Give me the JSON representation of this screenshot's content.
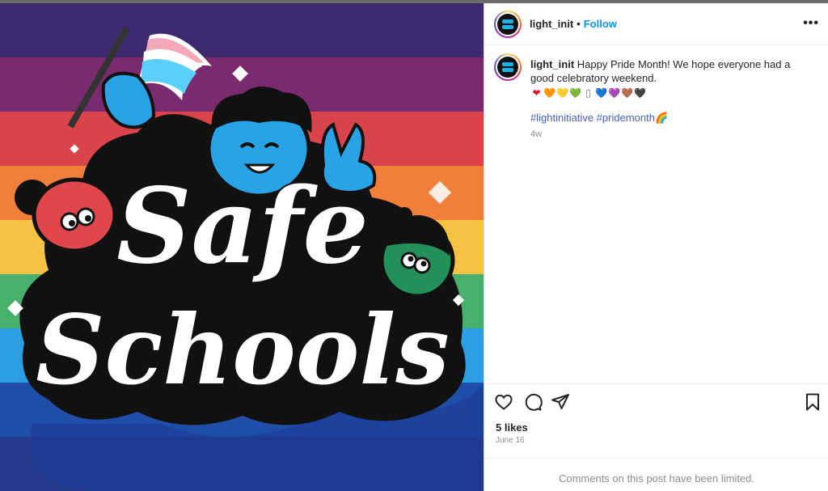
{
  "post_image": {
    "artwork_title_line1": "Safe",
    "artwork_title_line2": "Schools",
    "stripe_colors": [
      "#3e2a6e",
      "#7a2a6e",
      "#d9434a",
      "#f07f3a",
      "#f6c244",
      "#47b06d",
      "#2a9ee0",
      "#1f4ea8",
      "#233a8a"
    ]
  },
  "header": {
    "username": "light_init",
    "separator": "•",
    "follow_label": "Follow",
    "more_label": "•••"
  },
  "caption": {
    "username": "light_init",
    "text_line": "Happy Pride Month! We hope everyone had a good celebratory weekend.",
    "hearts": [
      "❤",
      "🧡",
      "💛",
      "💚",
      "▯",
      "💙",
      "💜",
      "🤎",
      "🖤"
    ],
    "heart_colors": [
      "#e0162b",
      "#f57c00",
      "#f4c20d",
      "#3cb043",
      "#777777",
      "#1e88e5",
      "#8e44ad",
      "#8b5a2b",
      "#222222"
    ],
    "hashtag_1": "#lightinitiative",
    "hashtag_2": "#pridemonth🌈",
    "time_ago": "4w"
  },
  "actions": {
    "likes": "5 likes",
    "date": "June 16"
  },
  "comments": {
    "limited_text": "Comments on this post have been limited."
  }
}
